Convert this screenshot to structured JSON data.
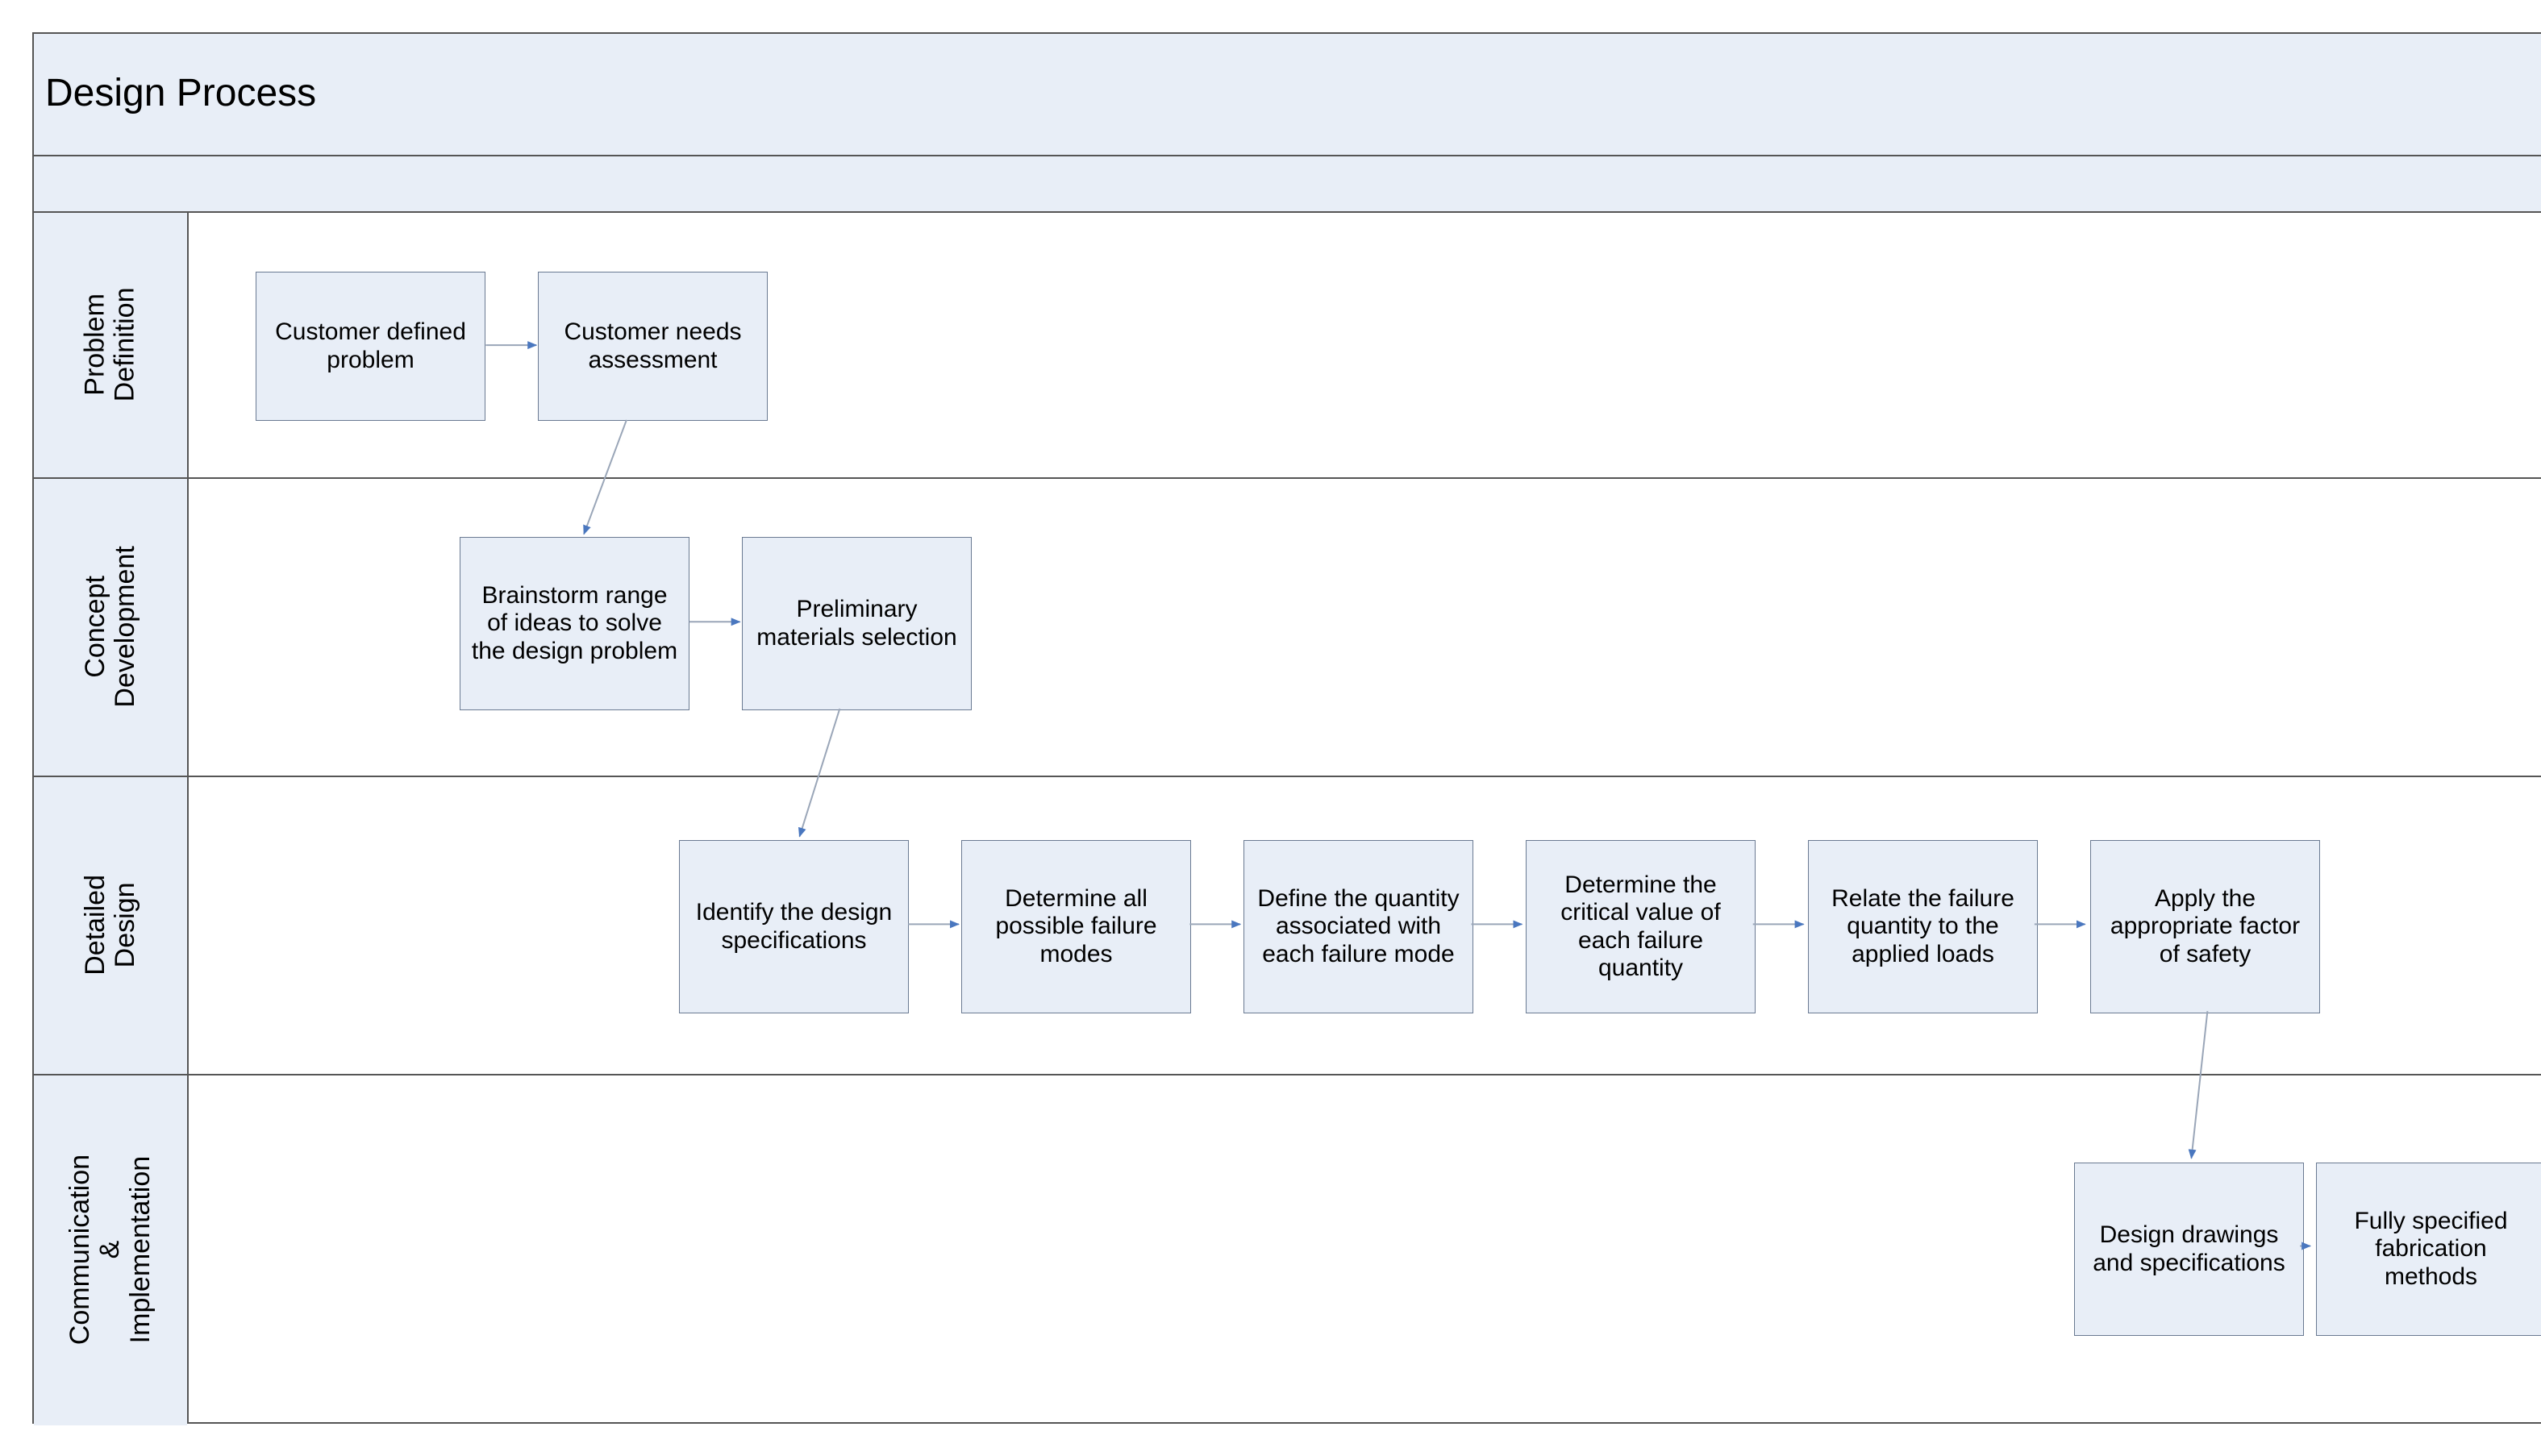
{
  "title": "Design Process",
  "lanes": [
    {
      "id": "problem-definition",
      "label": "Problem\nDefinition"
    },
    {
      "id": "concept-development",
      "label": "Concept\nDevelopment"
    },
    {
      "id": "detailed-design",
      "label": "Detailed\nDesign"
    },
    {
      "id": "communication-implementation",
      "label": "Communication\n&\nImplementation"
    }
  ],
  "nodes": {
    "n1": "Customer defined problem",
    "n2": "Customer needs assessment",
    "n3": "Brainstorm range of ideas to solve the design problem",
    "n4": "Preliminary materials selection",
    "n5": "Identify the design specifications",
    "n6": "Determine all possible failure modes",
    "n7": "Define the quantity associated with each failure mode",
    "n8": "Determine the critical value of each failure quantity",
    "n9": "Relate the failure quantity to the applied loads",
    "n10": "Apply the appropriate factor of safety",
    "n11": "Design drawings and specifications",
    "n12": "Fully specified fabrication methods"
  },
  "colors": {
    "accent": "#4a77bf",
    "node_bg": "#e8eef7",
    "node_border": "#6a7a92",
    "rule": "#555555"
  }
}
